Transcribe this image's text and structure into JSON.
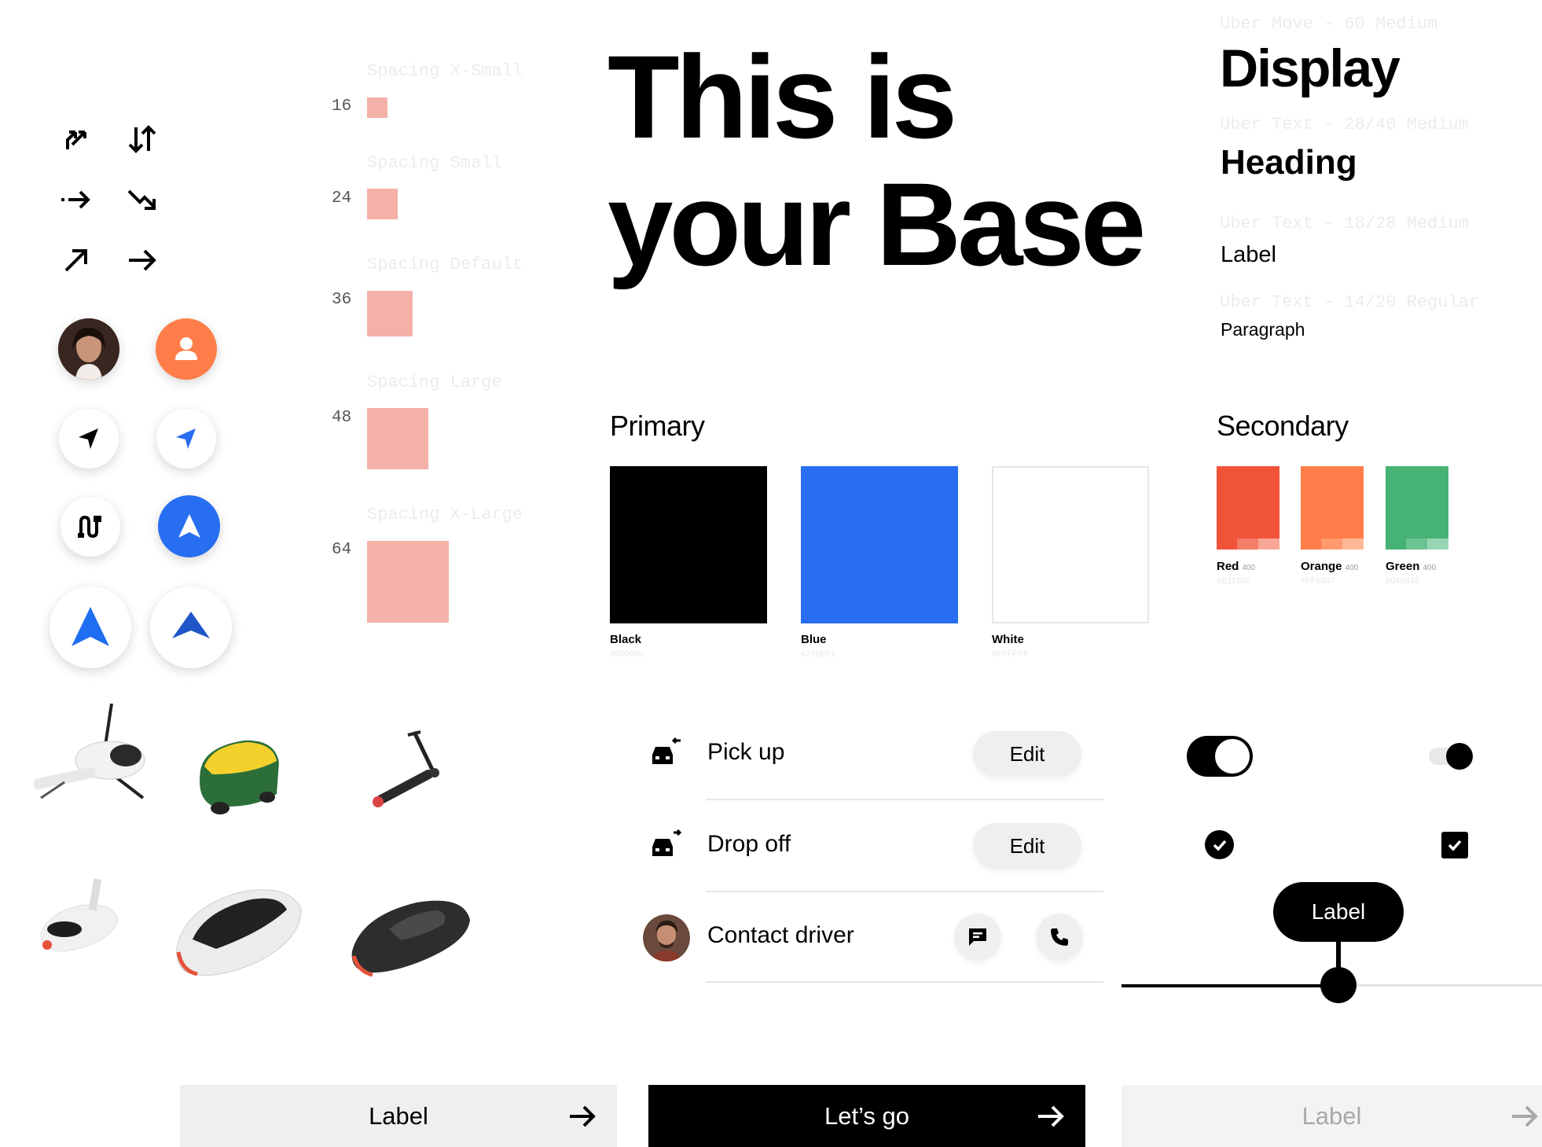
{
  "spacing": [
    {
      "label": "Spacing X-Small",
      "value": "16"
    },
    {
      "label": "Spacing Small",
      "value": "24"
    },
    {
      "label": "Spacing Default",
      "value": "36"
    },
    {
      "label": "Spacing Large",
      "value": "48"
    },
    {
      "label": "Spacing X-Large",
      "value": "64"
    }
  ],
  "hero": {
    "line1": "This is",
    "line2": "your Base"
  },
  "typography": {
    "display_spec": "Uber Move - 60 Medium",
    "display": "Display",
    "heading_spec": "Uber Text - 28/40 Medium",
    "heading": "Heading",
    "label_spec": "Uber Text - 18/28 Medium",
    "label": "Label",
    "paragraph_spec": "Uber Text - 14/20 Regular",
    "paragraph": "Paragraph"
  },
  "colors": {
    "primary_title": "Primary",
    "primary": [
      {
        "name": "Black",
        "hex": "#000000",
        "color": "#000000"
      },
      {
        "name": "Blue",
        "hex": "#276EF1",
        "color": "#276EF1"
      },
      {
        "name": "White",
        "hex": "#FFFFFF",
        "color": "#FFFFFF"
      }
    ],
    "secondary_title": "Secondary",
    "secondary": [
      {
        "name": "Red",
        "weight": "400",
        "hex": "#E11900",
        "color": "#F15339"
      },
      {
        "name": "Orange",
        "weight": "400",
        "hex": "#FF6937",
        "color": "#FF7D49"
      },
      {
        "name": "Green",
        "weight": "400",
        "hex": "#048848",
        "color": "#47B275"
      }
    ]
  },
  "icons": {
    "arrows": [
      "swap-arrow-icon",
      "sort-arrows-icon",
      "dashed-arrow-icon",
      "trend-down-arrow-icon",
      "arrow-up-right-icon",
      "arrow-right-icon"
    ],
    "avatar_placeholder_color": "#FF7D49",
    "navigation_blue": "#276EF1"
  },
  "trip": {
    "pickup": {
      "label": "Pick up",
      "action": "Edit"
    },
    "dropoff": {
      "label": "Drop off",
      "action": "Edit"
    },
    "contact": {
      "label": "Contact driver"
    }
  },
  "controls": {
    "toggle_on": true,
    "toggle_small_on": true,
    "check_round": true,
    "check_square": true,
    "slider_tooltip": "Label",
    "slider_value": 0.53
  },
  "buttons": {
    "secondary": "Label",
    "primary": "Let’s go",
    "disabled": "Label"
  },
  "vehicles": [
    "helicopter",
    "auto-rickshaw",
    "scooter",
    "moped",
    "minivan",
    "sedan"
  ]
}
